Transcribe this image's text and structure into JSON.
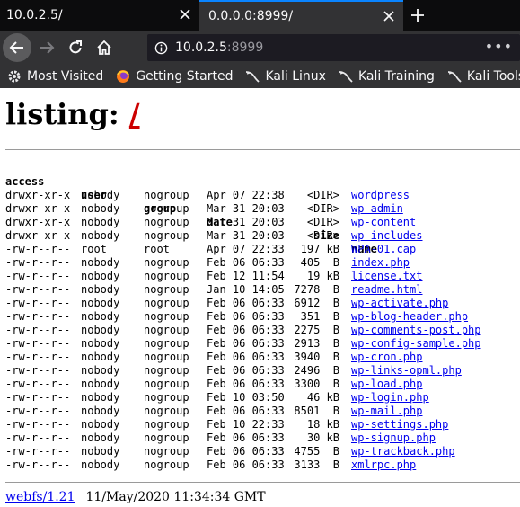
{
  "tabs": [
    {
      "title": "10.0.2.5/",
      "active": false
    },
    {
      "title": "0.0.0.0:8999/",
      "active": true
    }
  ],
  "urlbar": {
    "host": "10.0.2.5",
    "port": ":8999"
  },
  "bookmarks": [
    {
      "label": "Most Visited",
      "icon": "gear-icon"
    },
    {
      "label": "Getting Started",
      "icon": "firefox-icon"
    },
    {
      "label": "Kali Linux",
      "icon": "kali-dragon-icon"
    },
    {
      "label": "Kali Training",
      "icon": "kali-dragon-icon"
    },
    {
      "label": "Kali Tools",
      "icon": "kali-dragon-icon"
    }
  ],
  "page": {
    "heading_prefix": "listing: ",
    "heading_path": "/",
    "columns": {
      "access": "access",
      "user": "user",
      "group": "group",
      "date": "date",
      "size": "size",
      "name": "name"
    },
    "rows": [
      {
        "access": "drwxr-xr-x",
        "user": "nobody",
        "group": "nogroup",
        "date": "Apr 07 22:38",
        "size": "<DIR>",
        "name": "wordpress"
      },
      {
        "access": "drwxr-xr-x",
        "user": "nobody",
        "group": "nogroup",
        "date": "Mar 31 20:03",
        "size": "<DIR>",
        "name": "wp-admin"
      },
      {
        "access": "drwxr-xr-x",
        "user": "nobody",
        "group": "nogroup",
        "date": "Mar 31 20:03",
        "size": "<DIR>",
        "name": "wp-content"
      },
      {
        "access": "drwxr-xr-x",
        "user": "nobody",
        "group": "nogroup",
        "date": "Mar 31 20:03",
        "size": "<DIR>",
        "name": "wp-includes"
      },
      {
        "access": "-rw-r--r--",
        "user": "root",
        "group": "root",
        "date": "Apr 07 22:33",
        "size": "197 kB",
        "name": "WPA-01.cap"
      },
      {
        "access": "-rw-r--r--",
        "user": "nobody",
        "group": "nogroup",
        "date": "Feb 06 06:33",
        "size": "405  B",
        "name": "index.php"
      },
      {
        "access": "-rw-r--r--",
        "user": "nobody",
        "group": "nogroup",
        "date": "Feb 12 11:54",
        "size": "19 kB",
        "name": "license.txt"
      },
      {
        "access": "-rw-r--r--",
        "user": "nobody",
        "group": "nogroup",
        "date": "Jan 10 14:05",
        "size": "7278  B",
        "name": "readme.html"
      },
      {
        "access": "-rw-r--r--",
        "user": "nobody",
        "group": "nogroup",
        "date": "Feb 06 06:33",
        "size": "6912  B",
        "name": "wp-activate.php"
      },
      {
        "access": "-rw-r--r--",
        "user": "nobody",
        "group": "nogroup",
        "date": "Feb 06 06:33",
        "size": "351  B",
        "name": "wp-blog-header.php"
      },
      {
        "access": "-rw-r--r--",
        "user": "nobody",
        "group": "nogroup",
        "date": "Feb 06 06:33",
        "size": "2275  B",
        "name": "wp-comments-post.php"
      },
      {
        "access": "-rw-r--r--",
        "user": "nobody",
        "group": "nogroup",
        "date": "Feb 06 06:33",
        "size": "2913  B",
        "name": "wp-config-sample.php"
      },
      {
        "access": "-rw-r--r--",
        "user": "nobody",
        "group": "nogroup",
        "date": "Feb 06 06:33",
        "size": "3940  B",
        "name": "wp-cron.php"
      },
      {
        "access": "-rw-r--r--",
        "user": "nobody",
        "group": "nogroup",
        "date": "Feb 06 06:33",
        "size": "2496  B",
        "name": "wp-links-opml.php"
      },
      {
        "access": "-rw-r--r--",
        "user": "nobody",
        "group": "nogroup",
        "date": "Feb 06 06:33",
        "size": "3300  B",
        "name": "wp-load.php"
      },
      {
        "access": "-rw-r--r--",
        "user": "nobody",
        "group": "nogroup",
        "date": "Feb 10 03:50",
        "size": "46 kB",
        "name": "wp-login.php"
      },
      {
        "access": "-rw-r--r--",
        "user": "nobody",
        "group": "nogroup",
        "date": "Feb 06 06:33",
        "size": "8501  B",
        "name": "wp-mail.php"
      },
      {
        "access": "-rw-r--r--",
        "user": "nobody",
        "group": "nogroup",
        "date": "Feb 10 22:33",
        "size": "18 kB",
        "name": "wp-settings.php"
      },
      {
        "access": "-rw-r--r--",
        "user": "nobody",
        "group": "nogroup",
        "date": "Feb 06 06:33",
        "size": "30 kB",
        "name": "wp-signup.php"
      },
      {
        "access": "-rw-r--r--",
        "user": "nobody",
        "group": "nogroup",
        "date": "Feb 06 06:33",
        "size": "4755  B",
        "name": "wp-trackback.php"
      },
      {
        "access": "-rw-r--r--",
        "user": "nobody",
        "group": "nogroup",
        "date": "Feb 06 06:33",
        "size": "3133  B",
        "name": "xmlrpc.php"
      }
    ],
    "footer": {
      "link": "webfs/1.21",
      "timestamp": "11/May/2020 11:34:34 GMT"
    }
  },
  "colors": {
    "tab_accent": "#0a84ff",
    "heading_path": "#cc0000",
    "link": "#0000ee"
  }
}
